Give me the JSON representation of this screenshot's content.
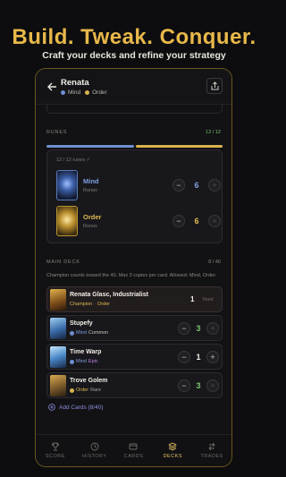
{
  "promo": {
    "title": "Build. Tweak. Conquer.",
    "subtitle": "Craft your decks and refine your strategy"
  },
  "header": {
    "deck_name": "Renata",
    "tag1": "Mind",
    "tag2": "Order"
  },
  "runes": {
    "label": "RUNES",
    "count": "12 / 12",
    "note": "12 / 12 runes ✓",
    "items": [
      {
        "name": "Mind",
        "sub": "Runes",
        "value": "6",
        "minus": "−",
        "plus": "+"
      },
      {
        "name": "Order",
        "sub": "Runes",
        "value": "6",
        "minus": "−",
        "plus": "+"
      }
    ]
  },
  "main_deck": {
    "label": "MAIN DECK",
    "count": "8 / 40",
    "hint": "Champion counts toward the 40. Max 3 copies per card. Allowed: Mind, Order.",
    "cards": [
      {
        "name": "Renata Glasc, Industrialist",
        "domain": "Champion",
        "rarity": "Order",
        "qty": "1",
        "extra": "fixed"
      },
      {
        "name": "Stupefy",
        "domain": "Mind",
        "rarity": "Common",
        "qty": "3",
        "minus": "−",
        "plus": "+"
      },
      {
        "name": "Time Warp",
        "domain": "Mind",
        "rarity": "Epic",
        "qty": "1",
        "minus": "−",
        "plus": "+"
      },
      {
        "name": "Trove Golem",
        "domain": "Order",
        "rarity": "Rare",
        "qty": "3",
        "minus": "−",
        "plus": "+"
      }
    ],
    "add_label": "Add Cards (8/40)"
  },
  "tabs": [
    "SCORE",
    "HISTORY",
    "CARDS",
    "DECKS",
    "TRADES"
  ],
  "colors": {
    "accent": "#e8b84a",
    "mind": "#6d8fd0",
    "order": "#d9b24c",
    "count_green": "#7cc46a"
  }
}
